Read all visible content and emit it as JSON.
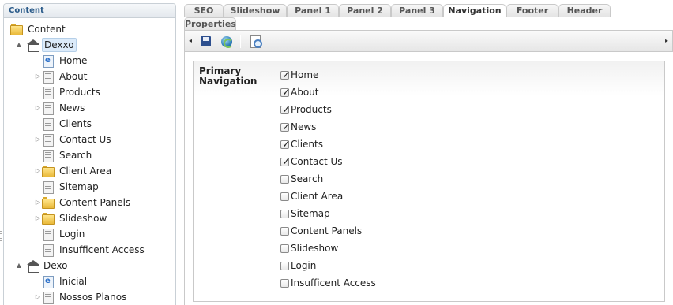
{
  "tree": {
    "header": "Content",
    "nodes": [
      {
        "label": "Content",
        "icon": "folder-icon",
        "level": 0,
        "toggle": ""
      },
      {
        "label": "Dexxo",
        "icon": "site-home-icon",
        "level": 1,
        "toggle": "▲",
        "selected": true
      },
      {
        "label": "Home",
        "icon": "home-page-icon",
        "level": 2,
        "toggle": ""
      },
      {
        "label": "About",
        "icon": "page-icon",
        "level": 2,
        "toggle": "▷"
      },
      {
        "label": "Products",
        "icon": "page-icon",
        "level": 2,
        "toggle": ""
      },
      {
        "label": "News",
        "icon": "page-icon",
        "level": 2,
        "toggle": "▷"
      },
      {
        "label": "Clients",
        "icon": "page-icon",
        "level": 2,
        "toggle": ""
      },
      {
        "label": "Contact Us",
        "icon": "page-icon",
        "level": 2,
        "toggle": "▷"
      },
      {
        "label": "Search",
        "icon": "page-icon",
        "level": 2,
        "toggle": ""
      },
      {
        "label": "Client Area",
        "icon": "folder-icon",
        "level": 2,
        "toggle": "▷"
      },
      {
        "label": "Sitemap",
        "icon": "page-icon",
        "level": 2,
        "toggle": ""
      },
      {
        "label": "Content Panels",
        "icon": "folder-icon",
        "level": 2,
        "toggle": "▷"
      },
      {
        "label": "Slideshow",
        "icon": "folder-icon",
        "level": 2,
        "toggle": "▷"
      },
      {
        "label": "Login",
        "icon": "page-icon",
        "level": 2,
        "toggle": ""
      },
      {
        "label": "Insufficent Access",
        "icon": "page-icon",
        "level": 2,
        "toggle": ""
      },
      {
        "label": "Dexo",
        "icon": "site-home-icon",
        "level": 1,
        "toggle": "▲"
      },
      {
        "label": "Inicial",
        "icon": "home-page-icon",
        "level": 2,
        "toggle": ""
      },
      {
        "label": "Nossos Planos",
        "icon": "page-icon",
        "level": 2,
        "toggle": "▷"
      }
    ]
  },
  "tabs": [
    {
      "label": "SEO",
      "active": false,
      "row": 0
    },
    {
      "label": "Slideshow",
      "active": false,
      "row": 0
    },
    {
      "label": "Panel 1",
      "active": false,
      "row": 0
    },
    {
      "label": "Panel 2",
      "active": false,
      "row": 0
    },
    {
      "label": "Panel 3",
      "active": false,
      "row": 0
    },
    {
      "label": "Navigation",
      "active": true,
      "row": 0
    },
    {
      "label": "Footer",
      "active": false,
      "row": 0
    },
    {
      "label": "Header",
      "active": false,
      "row": 0
    },
    {
      "label": "Properties",
      "active": false,
      "row": 1
    }
  ],
  "toolbar": {
    "left_arrow": "◂",
    "right_arrow": "▸",
    "buttons": [
      "save-icon",
      "refresh-icon",
      "preview-icon"
    ]
  },
  "form": {
    "field_label": "Primary Navigation",
    "options": [
      {
        "label": "Home",
        "checked": true
      },
      {
        "label": "About",
        "checked": true
      },
      {
        "label": "Products",
        "checked": true
      },
      {
        "label": "News",
        "checked": true
      },
      {
        "label": "Clients",
        "checked": true
      },
      {
        "label": "Contact Us",
        "checked": true
      },
      {
        "label": "Search",
        "checked": false
      },
      {
        "label": "Client Area",
        "checked": false
      },
      {
        "label": "Sitemap",
        "checked": false
      },
      {
        "label": "Content Panels",
        "checked": false
      },
      {
        "label": "Slideshow",
        "checked": false
      },
      {
        "label": "Login",
        "checked": false
      },
      {
        "label": "Insufficent Access",
        "checked": false
      }
    ]
  }
}
